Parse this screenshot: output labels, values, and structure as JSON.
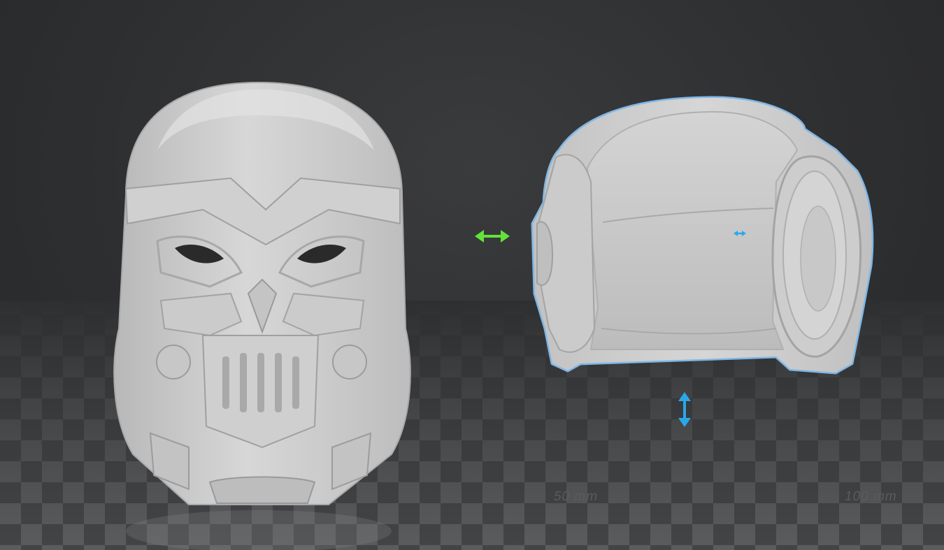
{
  "viewport": {
    "background_color": "#2e2f31",
    "floor_light": "#5f6062",
    "floor_dark": "#3e3f41"
  },
  "models": {
    "mask": {
      "color": "#cfcfcf",
      "selected": false
    },
    "helmet": {
      "color": "#cdcdcd",
      "selected": true,
      "outline_color": "#7fb6e6"
    }
  },
  "gizmos": {
    "move_x": {
      "icon": "double-arrow-horizontal-icon",
      "color": "#62e23a"
    },
    "move_z": {
      "icon": "double-arrow-vertical-icon",
      "color": "#2aa7ea"
    },
    "move_y": {
      "icon": "double-arrow-small-icon",
      "color": "#2aa7ea"
    }
  },
  "ruler": {
    "mark_50": "50 mm",
    "mark_100": "100 mm"
  }
}
